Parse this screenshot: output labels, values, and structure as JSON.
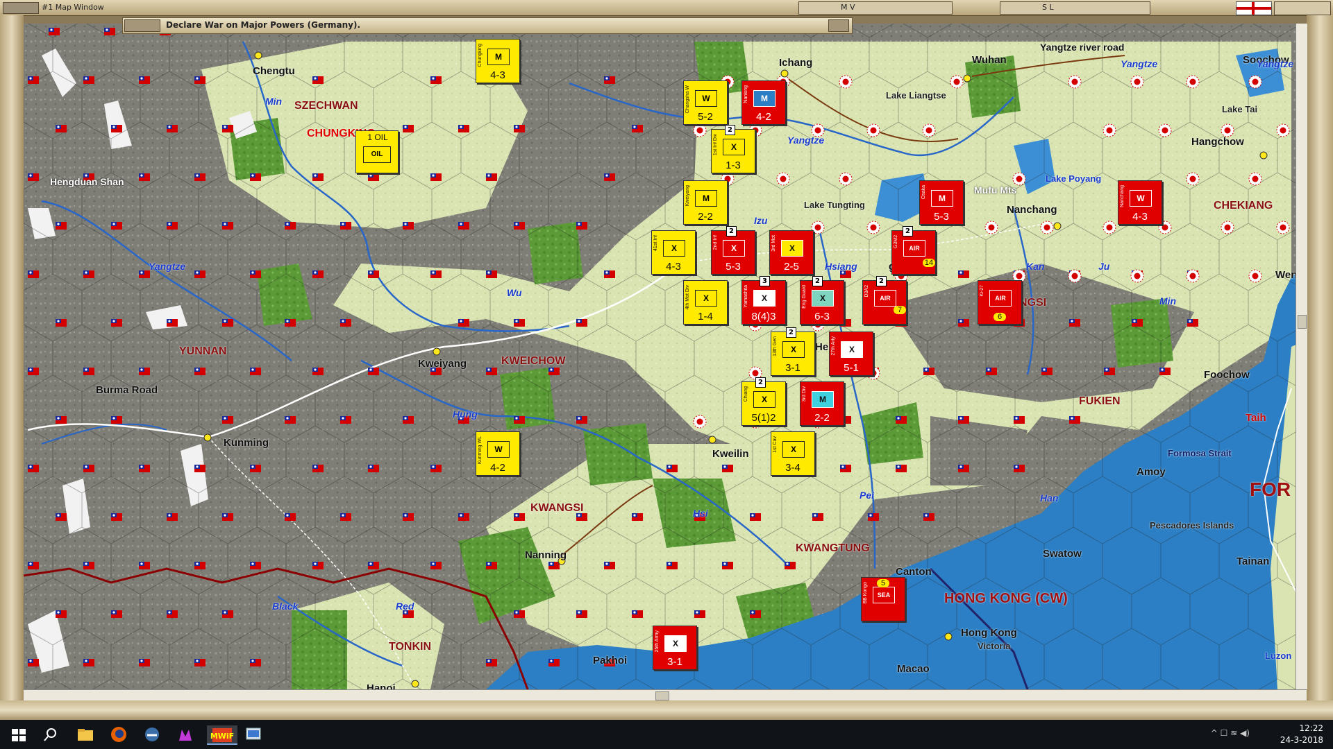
{
  "window": {
    "title": "#1 Map Window",
    "buttons": [
      "M V",
      "S L"
    ],
    "message": "Declare War on Major Powers (Germany)."
  },
  "regions": [
    {
      "name": "SZECHWAN"
    },
    {
      "name": "CHUNGKING"
    },
    {
      "name": "YUNNAN"
    },
    {
      "name": "KWEICHOW"
    },
    {
      "name": "KWANGSI"
    },
    {
      "name": "KWANGTUNG"
    },
    {
      "name": "TONKIN"
    },
    {
      "name": "FUKIEN"
    },
    {
      "name": "CHEKIANG"
    },
    {
      "name": "HONG KONG (CW)"
    },
    {
      "name": "FOR"
    },
    {
      "name": "NGSI"
    }
  ],
  "cities": [
    {
      "name": "Chengtu"
    },
    {
      "name": "Ichang"
    },
    {
      "name": "Wuhan"
    },
    {
      "name": "Soochow"
    },
    {
      "name": "Hangchow"
    },
    {
      "name": "Nanchang"
    },
    {
      "name": "Kweiyang"
    },
    {
      "name": "Kunming"
    },
    {
      "name": "Hengyang"
    },
    {
      "name": "Kweilin"
    },
    {
      "name": "Nanning"
    },
    {
      "name": "Canton"
    },
    {
      "name": "Hong Kong"
    },
    {
      "name": "Victoria"
    },
    {
      "name": "Macao"
    },
    {
      "name": "Swatow"
    },
    {
      "name": "Amoy"
    },
    {
      "name": "Foochow"
    },
    {
      "name": "Wenc"
    },
    {
      "name": "Tainan"
    },
    {
      "name": "Pakhoi"
    },
    {
      "name": "Hanoi"
    },
    {
      "name": "Taih"
    },
    {
      "name": "Luzon"
    },
    {
      "name": "gsha"
    }
  ],
  "features": [
    {
      "name": "Hengduan Shan"
    },
    {
      "name": "Burma Road"
    },
    {
      "name": "Lake Liangtse"
    },
    {
      "name": "Lake Tungting"
    },
    {
      "name": "Lake Poyang"
    },
    {
      "name": "Mufu Mts"
    },
    {
      "name": "Lake Tai"
    },
    {
      "name": "Yangtze river road"
    },
    {
      "name": "Formosa Strait"
    },
    {
      "name": "Pescadores Islands"
    }
  ],
  "rivers": [
    {
      "name": "Min"
    },
    {
      "name": "Yangtze"
    },
    {
      "name": "Yangtze"
    },
    {
      "name": "Yangtze"
    },
    {
      "name": "Yangtze"
    },
    {
      "name": "Wu"
    },
    {
      "name": "Hung"
    },
    {
      "name": "Izu"
    },
    {
      "name": "Hsiang"
    },
    {
      "name": "Kan"
    },
    {
      "name": "Ju"
    },
    {
      "name": "Min"
    },
    {
      "name": "Pei"
    },
    {
      "name": "Hsi"
    },
    {
      "name": "Han"
    },
    {
      "name": "Black"
    },
    {
      "name": "Red"
    }
  ],
  "units": [
    {
      "side": "china",
      "symbol": "M",
      "strength": "4-3",
      "name": "Chungking"
    },
    {
      "side": "china",
      "symbol": "W",
      "strength": "5-2",
      "name": "Changsha W"
    },
    {
      "side": "japan",
      "symbol": "M",
      "strength": "4-2",
      "name": "Nanking"
    },
    {
      "side": "china",
      "symbol": "X",
      "strength": "1-3",
      "name": "1st Inf Div"
    },
    {
      "side": "china",
      "symbol": "OIL",
      "strength": "1 OIL",
      "name": ""
    },
    {
      "side": "china",
      "symbol": "M",
      "strength": "2-2",
      "name": "Kweiyang"
    },
    {
      "side": "japan",
      "symbol": "M",
      "strength": "5-3",
      "name": "Osaka"
    },
    {
      "side": "japan",
      "symbol": "W",
      "strength": "4-3",
      "name": "Nanchang"
    },
    {
      "side": "china",
      "symbol": "X",
      "strength": "4-3",
      "name": "41st Inf"
    },
    {
      "side": "japan",
      "symbol": "X",
      "strength": "5-3",
      "name": "2nd Inf"
    },
    {
      "side": "japan",
      "symbol": "X",
      "strength": "2-5",
      "name": "3rd Mot"
    },
    {
      "side": "japan",
      "symbol": "AIR",
      "strength": "14",
      "name": "G3M2"
    },
    {
      "side": "china",
      "symbol": "X",
      "strength": "1-4",
      "name": "4th Mot Div"
    },
    {
      "side": "japan",
      "symbol": "X",
      "strength": "8(4)3",
      "name": "Yamashita"
    },
    {
      "side": "japan",
      "symbol": "X",
      "strength": "6-3",
      "name": "Eng Guard"
    },
    {
      "side": "japan",
      "symbol": "AIR",
      "strength": "7",
      "name": "D3A2"
    },
    {
      "side": "japan",
      "symbol": "AIR",
      "strength": "6",
      "name": "Ki-27"
    },
    {
      "side": "china",
      "symbol": "X",
      "strength": "3-1",
      "name": "13th Gen"
    },
    {
      "side": "japan",
      "symbol": "X",
      "strength": "5-1",
      "name": "27th Arty"
    },
    {
      "side": "china",
      "symbol": "X",
      "strength": "5(1)2",
      "name": "Chiang"
    },
    {
      "side": "japan",
      "symbol": "M",
      "strength": "2-2",
      "name": "3rd Div"
    },
    {
      "side": "china",
      "symbol": "W",
      "strength": "4-2",
      "name": "Kunming WL"
    },
    {
      "side": "china",
      "symbol": "X",
      "strength": "3-4",
      "name": "1st Cav"
    },
    {
      "side": "japan",
      "symbol": "X",
      "strength": "3-1",
      "name": "25th Army"
    },
    {
      "side": "japan",
      "symbol": "SEA",
      "strength": "5",
      "name": "BB Kongo"
    }
  ],
  "stack_counts": [
    "2",
    "2",
    "2",
    "3",
    "2",
    "2",
    "2",
    "2"
  ],
  "clock": {
    "time": "12:22",
    "date": "24-3-2018"
  },
  "colors": {
    "china_unit": "#ffea00",
    "japan_unit": "#e40000",
    "mountain": "#8c8b84",
    "clear": "#dfe8b6",
    "forest": "#5f9e3a",
    "sea": "#2c7fc4"
  }
}
